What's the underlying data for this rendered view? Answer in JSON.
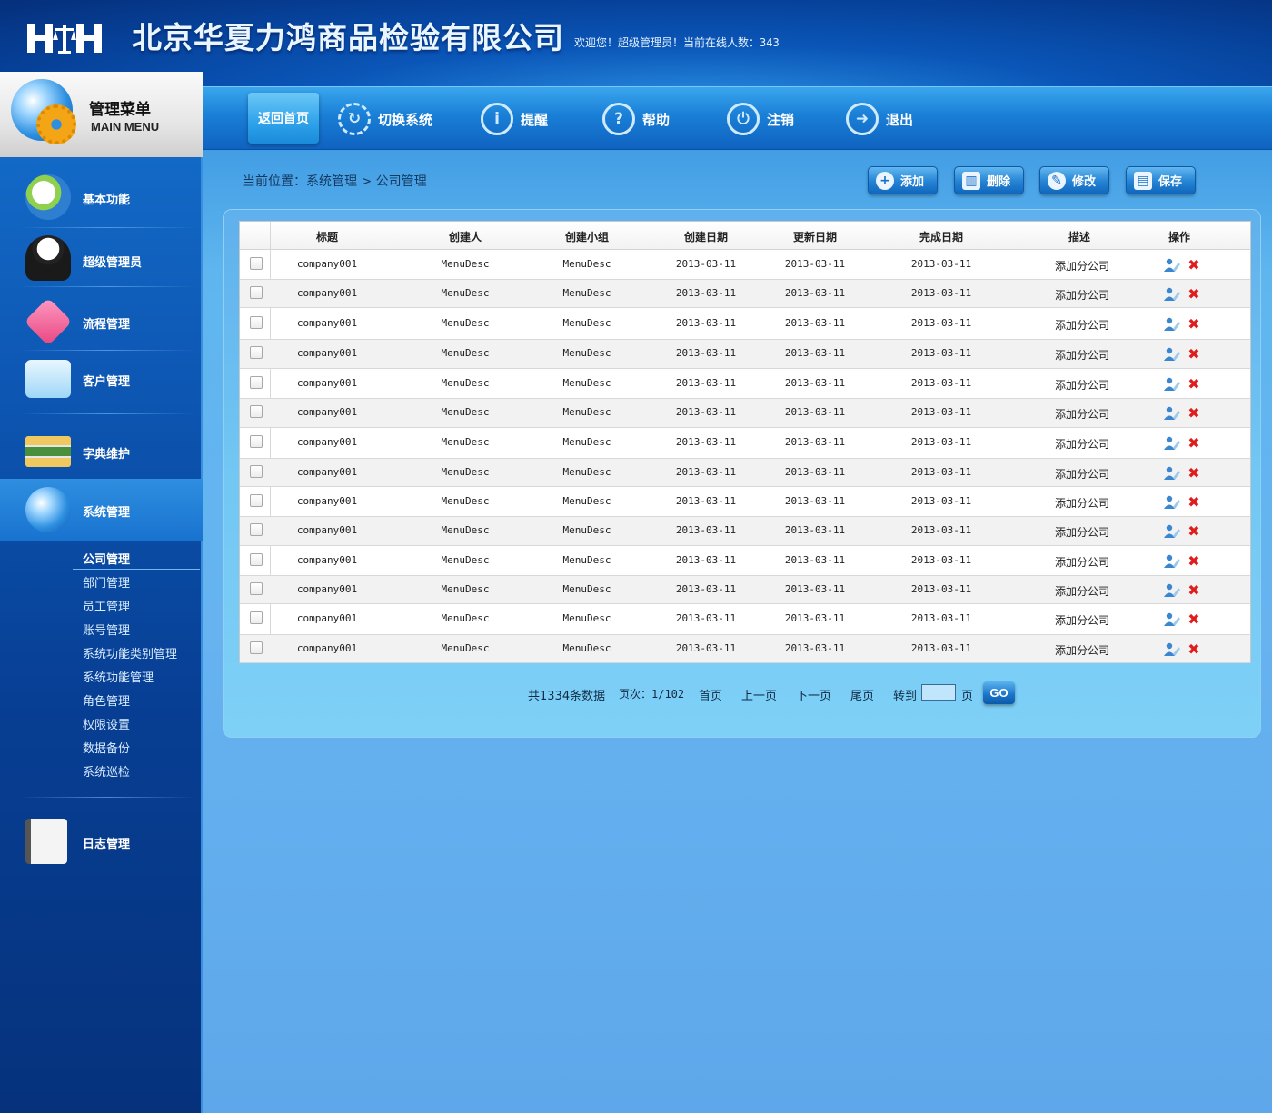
{
  "header": {
    "logo": "HH",
    "company_name": "北京华夏力鸿商品检验有限公司",
    "welcome": "欢迎您！超级管理员！当前在线人数：343"
  },
  "topnav": {
    "items": [
      {
        "label": "返回首页",
        "icon": "home"
      },
      {
        "label": "切换系统",
        "icon": "refresh-icon"
      },
      {
        "label": "提醒",
        "icon": "info-icon"
      },
      {
        "label": "帮助",
        "icon": "help-icon"
      },
      {
        "label": "注销",
        "icon": "power-icon"
      },
      {
        "label": "退出",
        "icon": "exit-arrow-icon"
      }
    ]
  },
  "sidebar": {
    "title_cn": "管理菜单",
    "title_en": "MAIN MENU",
    "items": [
      {
        "label": "基本功能",
        "icon": "refresh-hand-icon"
      },
      {
        "label": "超级管理员",
        "icon": "admin-user-icon"
      },
      {
        "label": "流程管理",
        "icon": "puzzle-icon"
      },
      {
        "label": "客户管理",
        "icon": "folder-icon"
      },
      {
        "label": "字典维护",
        "icon": "books-icon"
      },
      {
        "label": "系统管理",
        "icon": "globe-icon"
      },
      {
        "label": "日志管理",
        "icon": "notebook-icon"
      }
    ],
    "sub_items": [
      "公司管理",
      "部门管理",
      "员工管理",
      "账号管理",
      "系统功能类别管理",
      "系统功能管理",
      "角色管理",
      "权限设置",
      "数据备份",
      "系统巡检"
    ]
  },
  "breadcrumb": "当前位置：系统管理 > 公司管理",
  "toolbar": {
    "add": "添加",
    "delete": "删除",
    "edit": "修改",
    "save": "保存"
  },
  "table": {
    "headers": [
      "标题",
      "创建人",
      "创建小组",
      "创建日期",
      "更新日期",
      "完成日期",
      "描述",
      "操作"
    ],
    "rows": [
      [
        "company001",
        "MenuDesc",
        "MenuDesc",
        "2013-03-11",
        "2013-03-11",
        "2013-03-11",
        "添加分公司"
      ],
      [
        "company001",
        "MenuDesc",
        "MenuDesc",
        "2013-03-11",
        "2013-03-11",
        "2013-03-11",
        "添加分公司"
      ],
      [
        "company001",
        "MenuDesc",
        "MenuDesc",
        "2013-03-11",
        "2013-03-11",
        "2013-03-11",
        "添加分公司"
      ],
      [
        "company001",
        "MenuDesc",
        "MenuDesc",
        "2013-03-11",
        "2013-03-11",
        "2013-03-11",
        "添加分公司"
      ],
      [
        "company001",
        "MenuDesc",
        "MenuDesc",
        "2013-03-11",
        "2013-03-11",
        "2013-03-11",
        "添加分公司"
      ],
      [
        "company001",
        "MenuDesc",
        "MenuDesc",
        "2013-03-11",
        "2013-03-11",
        "2013-03-11",
        "添加分公司"
      ],
      [
        "company001",
        "MenuDesc",
        "MenuDesc",
        "2013-03-11",
        "2013-03-11",
        "2013-03-11",
        "添加分公司"
      ],
      [
        "company001",
        "MenuDesc",
        "MenuDesc",
        "2013-03-11",
        "2013-03-11",
        "2013-03-11",
        "添加分公司"
      ],
      [
        "company001",
        "MenuDesc",
        "MenuDesc",
        "2013-03-11",
        "2013-03-11",
        "2013-03-11",
        "添加分公司"
      ],
      [
        "company001",
        "MenuDesc",
        "MenuDesc",
        "2013-03-11",
        "2013-03-11",
        "2013-03-11",
        "添加分公司"
      ],
      [
        "company001",
        "MenuDesc",
        "MenuDesc",
        "2013-03-11",
        "2013-03-11",
        "2013-03-11",
        "添加分公司"
      ],
      [
        "company001",
        "MenuDesc",
        "MenuDesc",
        "2013-03-11",
        "2013-03-11",
        "2013-03-11",
        "添加分公司"
      ],
      [
        "company001",
        "MenuDesc",
        "MenuDesc",
        "2013-03-11",
        "2013-03-11",
        "2013-03-11",
        "添加分公司"
      ],
      [
        "company001",
        "MenuDesc",
        "MenuDesc",
        "2013-03-11",
        "2013-03-11",
        "2013-03-11",
        "添加分公司"
      ]
    ]
  },
  "pager": {
    "total": "共1334条数据",
    "page": "页次：1/102",
    "first": "首页",
    "prev": "上一页",
    "next": "下一页",
    "last": "尾页",
    "goto_label": "转到",
    "page_unit": "页",
    "goto_value": "",
    "go": "GO"
  },
  "colors": {
    "accent": "#1a73c9",
    "delete_red": "#e01d1d",
    "sidebar_dark": "#06327c"
  }
}
